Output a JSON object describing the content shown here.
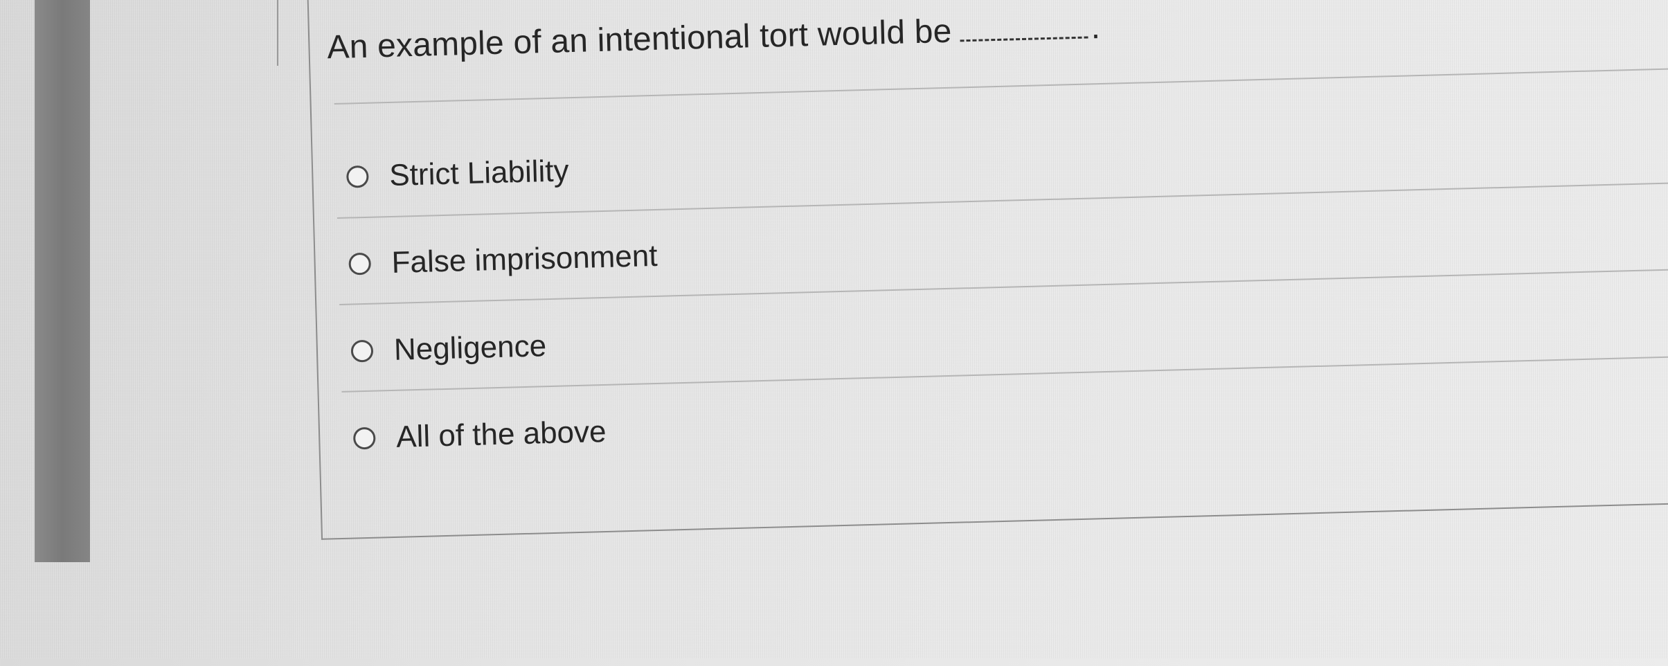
{
  "question": {
    "text": "An example of an intentional tort would be",
    "blank": "________",
    "end_punctuation": "."
  },
  "options": [
    {
      "label": "Strict Liability",
      "selected": false
    },
    {
      "label": "False imprisonment",
      "selected": false
    },
    {
      "label": "Negligence",
      "selected": false
    },
    {
      "label": "All of the above",
      "selected": false
    }
  ]
}
